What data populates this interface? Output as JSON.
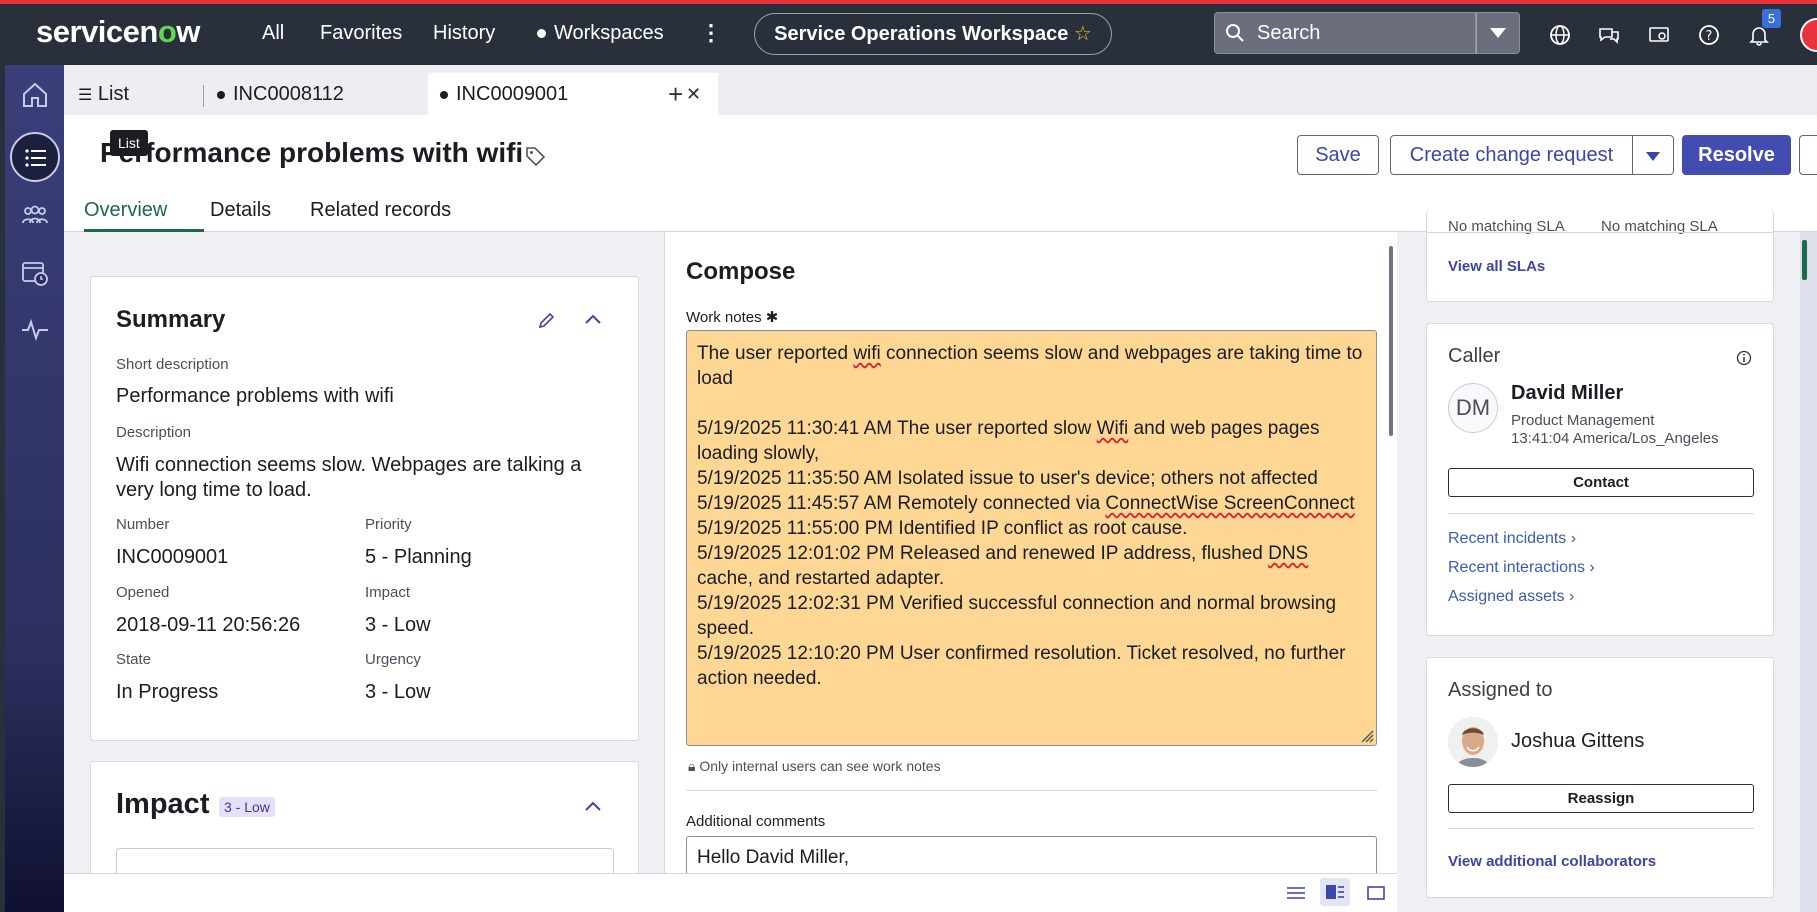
{
  "nav": {
    "logo": "servicenow",
    "links": [
      "All",
      "Favorites",
      "History"
    ],
    "workspaces": "Workspaces",
    "workspace_name": "Service Operations Workspace",
    "search_placeholder": "Search",
    "notification_count": "5"
  },
  "tabs": [
    {
      "label": "List"
    },
    {
      "label": "INC0008112"
    },
    {
      "label": "INC0009001"
    }
  ],
  "tooltip": "List",
  "record": {
    "title": "Performance problems with wifi",
    "buttons": {
      "save": "Save",
      "create_change": "Create change request",
      "resolve": "Resolve"
    },
    "subtabs": [
      "Overview",
      "Details",
      "Related records"
    ]
  },
  "summary": {
    "heading": "Summary",
    "short_description_label": "Short description",
    "short_description": "Performance problems with wifi",
    "description_label": "Description",
    "description": "Wifi connection seems slow. Webpages are talking a very long time to load.",
    "number_label": "Number",
    "number": "INC0009001",
    "priority_label": "Priority",
    "priority": "5 - Planning",
    "opened_label": "Opened",
    "opened": "2018-09-11 20:56:26",
    "impact_label": "Impact",
    "impact": "3 - Low",
    "state_label": "State",
    "state": "In Progress",
    "urgency_label": "Urgency",
    "urgency": "3 - Low"
  },
  "impact_card": {
    "heading": "Impact",
    "badge": "3 - Low"
  },
  "compose": {
    "heading": "Compose",
    "work_notes_label": "Work notes",
    "wn_line1a": "The user reported ",
    "wn_line1b": "wifi",
    "wn_line1c": " connection seems slow and webpages are taking time to load",
    "wn_line2a": "5/19/2025 11:30:41 AM The user reported slow ",
    "wn_line2b": "Wifi",
    "wn_line2c": " and web pages pages loading slowly,",
    "wn_line3": "5/19/2025 11:35:50 AM Isolated issue to user's device; others not affected",
    "wn_line4a": "5/19/2025 11:45:57 AM Remotely connected via ",
    "wn_line4b": "ConnectWise ScreenConnect",
    "wn_line5": "5/19/2025 11:55:00 PM Identified IP conflict as root cause.",
    "wn_line6a": "5/19/2025 12:01:02 PM Released and renewed IP address, flushed ",
    "wn_line6b": "DNS",
    "wn_line6c": " cache, and restarted adapter.",
    "wn_line7": "5/19/2025 12:02:31 PM Verified successful connection and normal browsing speed.",
    "wn_line8": "5/19/2025 12:10:20 PM User confirmed resolution. Ticket resolved, no further action needed.",
    "internal_note": "Only internal users can see work notes",
    "additional_comments_label": "Additional comments",
    "additional_comments_value": "Hello David Miller,"
  },
  "sla": {
    "sla_left": "No matching SLA",
    "sla_right": "No matching SLA",
    "view_all": "View all SLAs"
  },
  "caller": {
    "heading": "Caller",
    "initials": "DM",
    "name": "David Miller",
    "department": "Product Management",
    "local_time": "13:41:04 America/Los_Angeles",
    "contact": "Contact",
    "links": [
      "Recent incidents",
      "Recent interactions",
      "Assigned assets"
    ]
  },
  "assigned": {
    "heading": "Assigned to",
    "name": "Joshua Gittens",
    "reassign": "Reassign",
    "view_collaborators": "View additional collaborators"
  },
  "colors": {
    "accent": "#434caf",
    "nav_bg": "#2a2f3c",
    "work_notes_bg": "#fdd793",
    "brand_red": "#e8323c"
  }
}
